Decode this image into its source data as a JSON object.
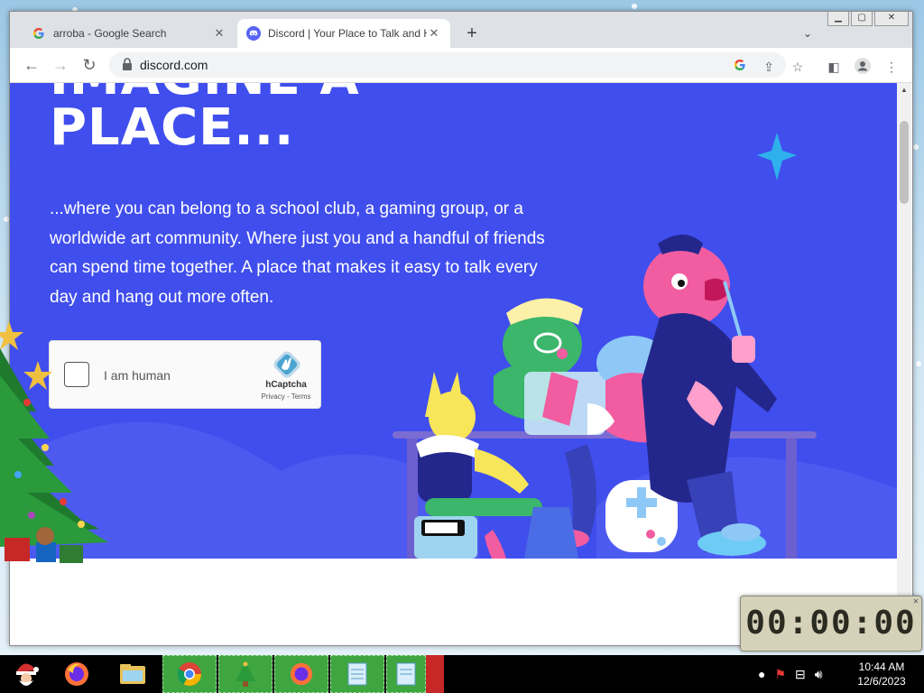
{
  "browser": {
    "tabs": [
      {
        "title": "arroba - Google Search",
        "favicon": "google-g-icon",
        "active": false
      },
      {
        "title": "Discord | Your Place to Talk and H",
        "favicon": "discord-icon",
        "active": true
      }
    ],
    "url": "discord.com"
  },
  "page": {
    "headline_line1": "IMAGINE A",
    "headline_line2": "PLACE...",
    "copy": "...where you can belong to a school club, a gaming group, or a worldwide art community. Where just you and a handful of friends can spend time together. A place that makes it easy to talk every day and hang out more often.",
    "captcha": {
      "label": "I am human",
      "brand": "hCaptcha",
      "links": "Privacy - Terms"
    }
  },
  "desktop": {
    "timer": "00:00:00",
    "taskbar_time": "10:44 AM",
    "taskbar_date": "12/6/2023"
  },
  "colors": {
    "discord_blurple": "#404eed",
    "taskbar": "#000000",
    "taskbar_green": "#3fa63f"
  }
}
